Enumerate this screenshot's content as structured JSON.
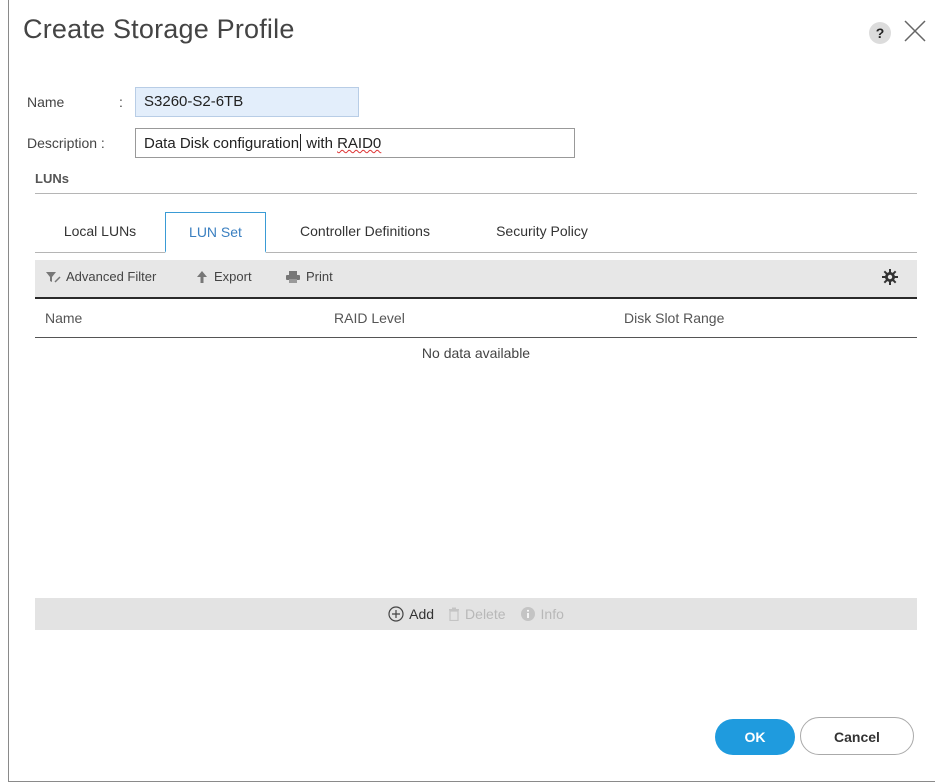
{
  "dialog": {
    "title": "Create Storage Profile",
    "help_label": "?",
    "close_icon": "close-icon"
  },
  "form": {
    "name_label": "Name",
    "name_colon": ":",
    "name_value": "S3260-S2-6TB",
    "description_label": "Description :",
    "description_value_before_caret": "Data Disk configuration",
    "description_value_after_caret": " with ",
    "description_value_misspelled": "RAID0"
  },
  "section": {
    "title": "LUNs"
  },
  "tabs": [
    {
      "label": "Local LUNs",
      "active": false
    },
    {
      "label": "LUN Set",
      "active": true
    },
    {
      "label": "Controller Definitions",
      "active": false
    },
    {
      "label": "Security Policy",
      "active": false
    }
  ],
  "toolbar": {
    "filter_label": "Advanced Filter",
    "export_label": "Export",
    "print_label": "Print",
    "settings_icon": "gear-icon"
  },
  "table": {
    "columns": [
      "Name",
      "RAID Level",
      "Disk Slot Range"
    ],
    "rows": [],
    "empty_message": "No data available"
  },
  "actions": {
    "add_label": "Add",
    "delete_label": "Delete",
    "info_label": "Info"
  },
  "buttons": {
    "ok_label": "OK",
    "cancel_label": "Cancel"
  },
  "colors": {
    "accent": "#1f9bde",
    "active_tab": "#3a9bd5",
    "name_field_bg": "#e3eefb"
  }
}
